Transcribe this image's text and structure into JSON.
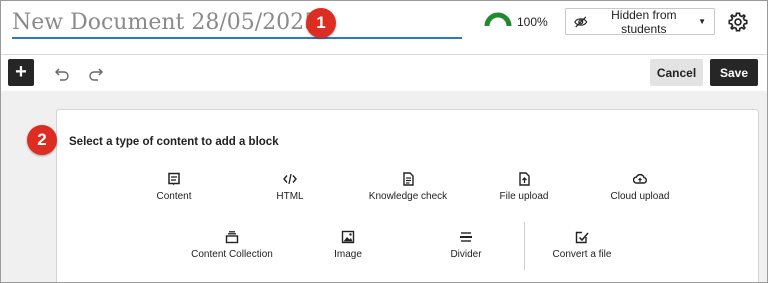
{
  "header": {
    "document_title": "New Document 28/05/2025",
    "progress_percent": 100,
    "progress_label": "100%",
    "visibility_label": "Hidden from students",
    "callout_1": "1"
  },
  "toolbar": {
    "add_label": "+",
    "cancel_label": "Cancel",
    "save_label": "Save"
  },
  "main": {
    "callout_2": "2",
    "heading": "Select a type of content to add a block",
    "options_row1": [
      {
        "label": "Content",
        "icon": "content-icon"
      },
      {
        "label": "HTML",
        "icon": "html-code-icon"
      },
      {
        "label": "Knowledge check",
        "icon": "knowledge-check-icon"
      },
      {
        "label": "File upload",
        "icon": "file-upload-icon"
      },
      {
        "label": "Cloud upload",
        "icon": "cloud-upload-icon"
      }
    ],
    "options_row2": [
      {
        "label": "Content Collection",
        "icon": "content-collection-icon"
      },
      {
        "label": "Image",
        "icon": "image-icon"
      },
      {
        "label": "Divider",
        "icon": "divider-icon"
      },
      {
        "label": "Convert a file",
        "icon": "convert-file-icon"
      }
    ]
  },
  "colors": {
    "accent_blue": "#2b78c5",
    "callout_red": "#dd2c22",
    "progress_green": "#1f8a2e",
    "dark_button": "#262626"
  }
}
